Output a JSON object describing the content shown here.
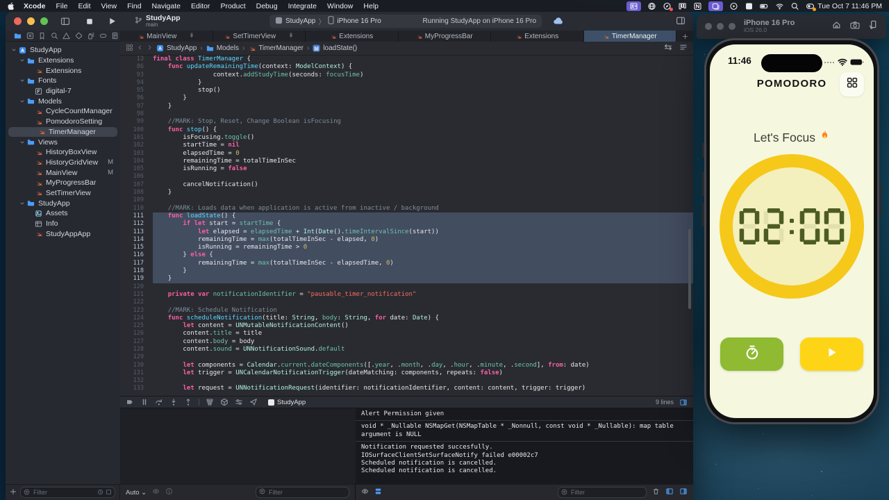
{
  "colors": {
    "accent_blue": "#4f9cf7",
    "tab_active": "#3e5068",
    "swift_orange": "#ed6f44",
    "gold_ring": "#f6c81a",
    "pale_yellow": "#f3f0bd",
    "phone_screen": "#f5f8de",
    "button_green": "#8fba31",
    "button_yellow": "#fed516",
    "lcd_green": "#4d5c23",
    "keyword": "#fc5fa3",
    "string": "#fc6a5d",
    "comment": "#7f8c98"
  },
  "menu_bar": {
    "items": [
      "Xcode",
      "File",
      "Edit",
      "View",
      "Find",
      "Navigate",
      "Editor",
      "Product",
      "Debug",
      "Integrate",
      "Window",
      "Help"
    ],
    "status_icons": [
      "contacts",
      "translate-globe",
      "safari",
      "columns",
      "notion",
      "stage-manager",
      "screen-record",
      "input-source",
      "battery",
      "wifi",
      "spotlight",
      "user-switch"
    ],
    "clock": "Tue Oct 7  11:46 PM"
  },
  "toolbar": {
    "project": "StudyApp",
    "branch": "main",
    "scheme_app": "StudyApp",
    "scheme_separator": "〉",
    "scheme_device": "iPhone 16 Pro",
    "run_status": "Running StudyApp on iPhone 16 Pro"
  },
  "navigator": {
    "icons": [
      "project-navigator",
      "source-control",
      "bookmarks",
      "find",
      "issues",
      "tests",
      "debug-gauge",
      "breakpoints",
      "reports"
    ],
    "filter_placeholder": "Filter",
    "tree": [
      {
        "label": "StudyApp",
        "type": "app",
        "level": 0,
        "chev": true
      },
      {
        "label": "Extensions",
        "type": "folder",
        "level": 1,
        "chev": true
      },
      {
        "label": "Extensions",
        "type": "swift",
        "level": 2
      },
      {
        "label": "Fonts",
        "type": "folder",
        "level": 1,
        "chev": true
      },
      {
        "label": "digital-7",
        "type": "font",
        "level": 2
      },
      {
        "label": "Models",
        "type": "folder",
        "level": 1,
        "chev": true
      },
      {
        "label": "CycleCountManager",
        "type": "swift",
        "level": 2
      },
      {
        "label": "PomodoroSetting",
        "type": "swift",
        "level": 2
      },
      {
        "label": "TimerManager",
        "type": "swift",
        "level": 2,
        "selected": true
      },
      {
        "label": "Views",
        "type": "folder",
        "level": 1,
        "chev": true
      },
      {
        "label": "HistoryBoxView",
        "type": "swift",
        "level": 2
      },
      {
        "label": "HistoryGridView",
        "type": "swift",
        "level": 2,
        "badge": "M"
      },
      {
        "label": "MainView",
        "type": "swift",
        "level": 2,
        "badge": "M"
      },
      {
        "label": "MyProgressBar",
        "type": "swift",
        "level": 2
      },
      {
        "label": "SetTimerView",
        "type": "swift",
        "level": 2
      },
      {
        "label": "StudyApp",
        "type": "folder",
        "level": 1,
        "chev": true
      },
      {
        "label": "Assets",
        "type": "assets",
        "level": 2
      },
      {
        "label": "Info",
        "type": "info",
        "level": 2
      },
      {
        "label": "StudyAppApp",
        "type": "swift",
        "level": 2
      }
    ]
  },
  "tabs": [
    {
      "label": "MainView",
      "pinned": true
    },
    {
      "label": "SetTimerView",
      "pinned": true
    },
    {
      "label": "Extensions"
    },
    {
      "label": "MyProgressBar"
    },
    {
      "label": "Extensions"
    },
    {
      "label": "TimerManager",
      "active": true
    }
  ],
  "jumpbar": {
    "crumbs": [
      {
        "icon": "app",
        "label": "StudyApp"
      },
      {
        "icon": "folder",
        "label": "Models"
      },
      {
        "icon": "swift",
        "label": "TimerManager"
      },
      {
        "icon": "method",
        "label": "loadState()"
      }
    ]
  },
  "editor": {
    "lines": [
      {
        "n": 13,
        "i": 0,
        "t": [
          [
            "k",
            "final"
          ],
          [
            "p",
            " "
          ],
          [
            "k",
            "class"
          ],
          [
            "p",
            " "
          ],
          [
            "d",
            "TimerManager"
          ],
          [
            "p",
            " {"
          ]
        ]
      },
      {
        "n": 86,
        "i": 4,
        "t": [
          [
            "k",
            "func"
          ],
          [
            "p",
            " "
          ],
          [
            "d",
            "updateRemainingTime"
          ],
          [
            "p",
            "(context: "
          ],
          [
            "t",
            "ModelContext"
          ],
          [
            "p",
            ") {"
          ]
        ]
      },
      {
        "n": 93,
        "i": 16,
        "t": [
          [
            "p",
            "context."
          ],
          [
            "m",
            "addStudyTime"
          ],
          [
            "p",
            "(seconds: "
          ],
          [
            "m",
            "focusTime"
          ],
          [
            "p",
            ")"
          ]
        ]
      },
      {
        "n": 94,
        "i": 12,
        "t": [
          [
            "p",
            "}"
          ]
        ]
      },
      {
        "n": 95,
        "i": 12,
        "t": [
          [
            "p",
            "stop()"
          ]
        ]
      },
      {
        "n": 96,
        "i": 8,
        "t": [
          [
            "p",
            "}"
          ]
        ]
      },
      {
        "n": 97,
        "i": 4,
        "t": [
          [
            "p",
            "}"
          ]
        ]
      },
      {
        "n": 98,
        "i": 0,
        "t": []
      },
      {
        "n": 99,
        "i": 4,
        "t": [
          [
            "c",
            "//MARK: Stop, Reset, Change Boolean isFocusing"
          ]
        ]
      },
      {
        "n": 100,
        "i": 4,
        "t": [
          [
            "k",
            "func"
          ],
          [
            "p",
            " "
          ],
          [
            "d",
            "stop"
          ],
          [
            "p",
            "() {"
          ]
        ]
      },
      {
        "n": 101,
        "i": 8,
        "t": [
          [
            "p",
            "isFocusing."
          ],
          [
            "m",
            "toggle"
          ],
          [
            "p",
            "()"
          ]
        ]
      },
      {
        "n": 102,
        "i": 8,
        "t": [
          [
            "p",
            "startTime = "
          ],
          [
            "k",
            "nil"
          ]
        ]
      },
      {
        "n": 103,
        "i": 8,
        "t": [
          [
            "p",
            "elapsedTime = "
          ],
          [
            "n2",
            "0"
          ]
        ]
      },
      {
        "n": 104,
        "i": 8,
        "t": [
          [
            "p",
            "remainingTime = totalTimeInSec"
          ]
        ]
      },
      {
        "n": 105,
        "i": 8,
        "t": [
          [
            "p",
            "isRunning = "
          ],
          [
            "k",
            "false"
          ]
        ]
      },
      {
        "n": 106,
        "i": 0,
        "t": []
      },
      {
        "n": 107,
        "i": 8,
        "t": [
          [
            "p",
            "cancelNotification()"
          ]
        ]
      },
      {
        "n": 108,
        "i": 4,
        "t": [
          [
            "p",
            "}"
          ]
        ]
      },
      {
        "n": 109,
        "i": 0,
        "t": []
      },
      {
        "n": 110,
        "i": 4,
        "t": [
          [
            "c",
            "//MARK: Loads data when application is active from inactive / background"
          ]
        ]
      },
      {
        "n": 111,
        "i": 4,
        "s": 1,
        "t": [
          [
            "k",
            "func"
          ],
          [
            "p",
            " "
          ],
          [
            "d",
            "loadState"
          ],
          [
            "p",
            "() {"
          ]
        ]
      },
      {
        "n": 112,
        "i": 8,
        "s": 1,
        "t": [
          [
            "k",
            "if"
          ],
          [
            "p",
            " "
          ],
          [
            "k",
            "let"
          ],
          [
            "p",
            " start = "
          ],
          [
            "m",
            "startTime"
          ],
          [
            "p",
            " {"
          ]
        ]
      },
      {
        "n": 113,
        "i": 12,
        "s": 1,
        "t": [
          [
            "k",
            "let"
          ],
          [
            "p",
            " elapsed = "
          ],
          [
            "m",
            "elapsedTime"
          ],
          [
            "p",
            " + "
          ],
          [
            "t",
            "Int"
          ],
          [
            "p",
            "("
          ],
          [
            "t",
            "Date"
          ],
          [
            "p",
            "()."
          ],
          [
            "m",
            "timeIntervalSince"
          ],
          [
            "p",
            "(start))"
          ]
        ]
      },
      {
        "n": 114,
        "i": 12,
        "s": 1,
        "t": [
          [
            "p",
            "remainingTime = "
          ],
          [
            "m",
            "max"
          ],
          [
            "p",
            "(totalTimeInSec - elapsed, "
          ],
          [
            "n2",
            "0"
          ],
          [
            "p",
            ")"
          ]
        ]
      },
      {
        "n": 115,
        "i": 12,
        "s": 1,
        "t": [
          [
            "p",
            "isRunning = remainingTime > "
          ],
          [
            "n2",
            "0"
          ]
        ]
      },
      {
        "n": 116,
        "i": 8,
        "s": 1,
        "t": [
          [
            "p",
            "} "
          ],
          [
            "k",
            "else"
          ],
          [
            "p",
            " {"
          ]
        ]
      },
      {
        "n": 117,
        "i": 12,
        "s": 1,
        "t": [
          [
            "p",
            "remainingTime = "
          ],
          [
            "m",
            "max"
          ],
          [
            "p",
            "(totalTimeInSec - elapsedTime, "
          ],
          [
            "n2",
            "0"
          ],
          [
            "p",
            ")"
          ]
        ]
      },
      {
        "n": 118,
        "i": 8,
        "s": 1,
        "t": [
          [
            "p",
            "}"
          ]
        ]
      },
      {
        "n": 119,
        "i": 4,
        "s": 1,
        "t": [
          [
            "p",
            "}"
          ]
        ]
      },
      {
        "n": 120,
        "i": 0,
        "t": []
      },
      {
        "n": 121,
        "i": 4,
        "t": [
          [
            "k",
            "private"
          ],
          [
            "p",
            " "
          ],
          [
            "k",
            "var"
          ],
          [
            "p",
            " "
          ],
          [
            "m",
            "notificationIdentifier"
          ],
          [
            "p",
            " = "
          ],
          [
            "s",
            "\"pausable_timer_notification\""
          ]
        ]
      },
      {
        "n": 122,
        "i": 0,
        "t": []
      },
      {
        "n": 123,
        "i": 4,
        "t": [
          [
            "c",
            "//MARK: Schedule Notification"
          ]
        ]
      },
      {
        "n": 124,
        "i": 4,
        "t": [
          [
            "k",
            "func"
          ],
          [
            "p",
            " "
          ],
          [
            "d",
            "scheduleNotification"
          ],
          [
            "p",
            "(title: "
          ],
          [
            "t",
            "String"
          ],
          [
            "p",
            ", "
          ],
          [
            "m",
            "body"
          ],
          [
            "p",
            ": "
          ],
          [
            "t",
            "String"
          ],
          [
            "p",
            ", "
          ],
          [
            "k",
            "for"
          ],
          [
            "p",
            " date: "
          ],
          [
            "t",
            "Date"
          ],
          [
            "p",
            ") {"
          ]
        ]
      },
      {
        "n": 125,
        "i": 8,
        "t": [
          [
            "k",
            "let"
          ],
          [
            "p",
            " content = "
          ],
          [
            "t",
            "UNMutableNotificationContent"
          ],
          [
            "p",
            "()"
          ]
        ]
      },
      {
        "n": 126,
        "i": 8,
        "t": [
          [
            "p",
            "content."
          ],
          [
            "m",
            "title"
          ],
          [
            "p",
            " = title"
          ]
        ]
      },
      {
        "n": 127,
        "i": 8,
        "t": [
          [
            "p",
            "content."
          ],
          [
            "m",
            "body"
          ],
          [
            "p",
            " = body"
          ]
        ]
      },
      {
        "n": 128,
        "i": 8,
        "t": [
          [
            "p",
            "content."
          ],
          [
            "m",
            "sound"
          ],
          [
            "p",
            " = "
          ],
          [
            "t",
            "UNNotificationSound"
          ],
          [
            "p",
            "."
          ],
          [
            "m",
            "default"
          ]
        ]
      },
      {
        "n": 129,
        "i": 0,
        "t": []
      },
      {
        "n": 130,
        "i": 8,
        "t": [
          [
            "k",
            "let"
          ],
          [
            "p",
            " components = "
          ],
          [
            "t",
            "Calendar"
          ],
          [
            "p",
            "."
          ],
          [
            "m",
            "current"
          ],
          [
            "p",
            "."
          ],
          [
            "m",
            "dateComponents"
          ],
          [
            "p",
            "([."
          ],
          [
            "m",
            "year"
          ],
          [
            "p",
            ", ."
          ],
          [
            "m",
            "month"
          ],
          [
            "p",
            ", ."
          ],
          [
            "m",
            "day"
          ],
          [
            "p",
            ", ."
          ],
          [
            "m",
            "hour"
          ],
          [
            "p",
            ", ."
          ],
          [
            "m",
            "minute"
          ],
          [
            "p",
            ", ."
          ],
          [
            "m",
            "second"
          ],
          [
            "p",
            "], "
          ],
          [
            "k",
            "from"
          ],
          [
            "p",
            ": date)"
          ]
        ]
      },
      {
        "n": 131,
        "i": 8,
        "t": [
          [
            "k",
            "let"
          ],
          [
            "p",
            " trigger = "
          ],
          [
            "t",
            "UNCalendarNotificationTrigger"
          ],
          [
            "p",
            "(dateMatching: components, repeats: "
          ],
          [
            "k",
            "false"
          ],
          [
            "p",
            ")"
          ]
        ]
      },
      {
        "n": 132,
        "i": 0,
        "t": []
      },
      {
        "n": 133,
        "i": 8,
        "t": [
          [
            "k",
            "let"
          ],
          [
            "p",
            " request = "
          ],
          [
            "t",
            "UNNotificationRequest"
          ],
          [
            "p",
            "(identifier: notificationIdentifier, content: content, trigger: trigger)"
          ]
        ]
      }
    ]
  },
  "debug_bar": {
    "icons": [
      "breakpoint",
      "pause",
      "step-over",
      "step-into",
      "step-out",
      "view-hierarchy",
      "memory-graph",
      "environment-overrides",
      "simulate-location"
    ],
    "process": "StudyApp",
    "lines_count": "9 lines"
  },
  "variables_pane": {
    "mode": "Auto",
    "filter_placeholder": "Filter"
  },
  "console": {
    "groups": [
      [
        "Alert Permission given"
      ],
      [
        "void * _Nullable NSMapGet(NSMapTable * _Nonnull, const void * _Nullable): map table argument is NULL"
      ],
      [
        "Notification requested succesfully.",
        "IOSurfaceClientSetSurfaceNotify failed e00002c7",
        "Scheduled notification is cancelled.",
        "Scheduled notification is cancelled."
      ]
    ],
    "filter_placeholder": "Filter"
  },
  "simulator": {
    "title": "iPhone 16 Pro",
    "os": "iOS 26.0"
  },
  "phone": {
    "time": "11:46",
    "app_title": "POMODORO",
    "focus_text": "Let's Focus",
    "timer_display": "02:00",
    "buttons": [
      {
        "name": "reset-timer",
        "icon": "timer-reset"
      },
      {
        "name": "start",
        "icon": "play-filled"
      }
    ]
  }
}
